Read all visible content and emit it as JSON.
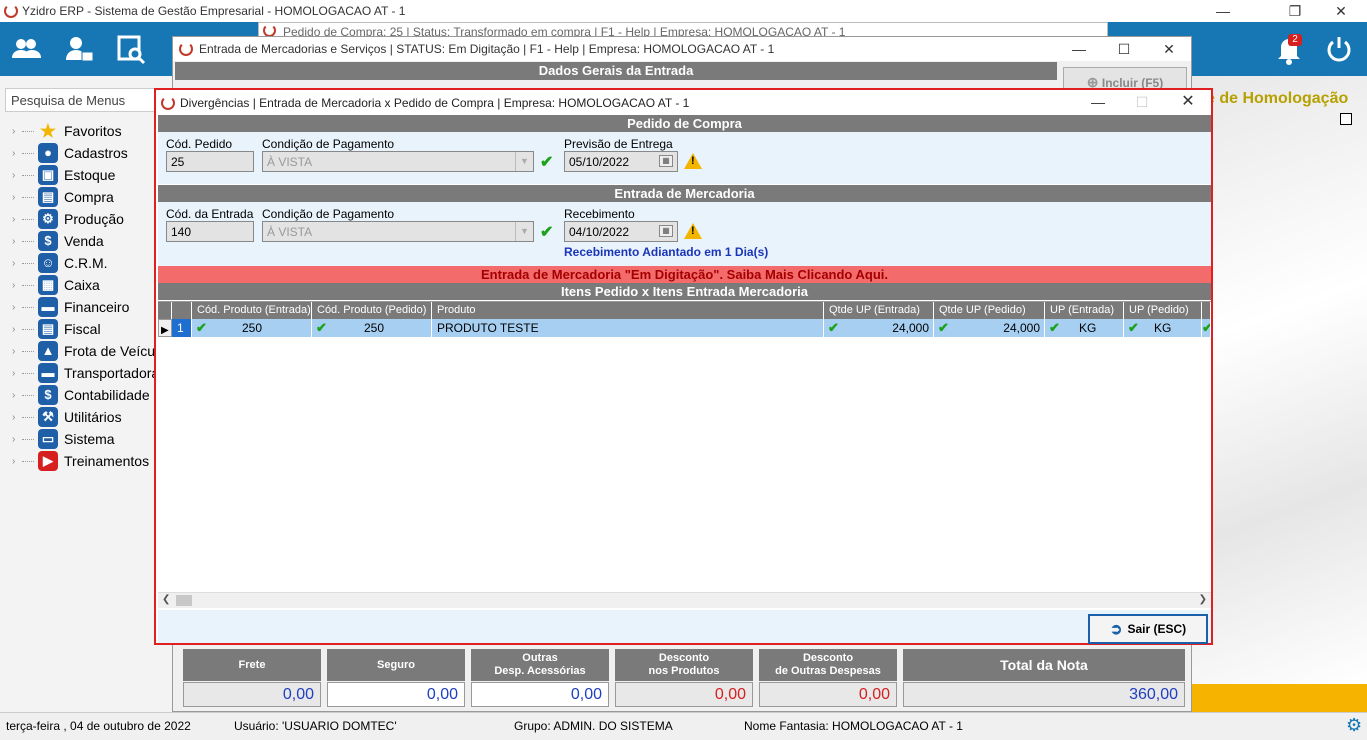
{
  "app": {
    "title": "Yzidro ERP - Sistema de Gestão Empresarial - HOMOLOGACAO AT - 1",
    "notifications_count": "2",
    "homolog_label": "e de Homologação"
  },
  "menu": {
    "search_placeholder": "Pesquisa de Menus",
    "items": [
      {
        "label": "Favoritos",
        "icon": "star-icon",
        "color": "#f2b600"
      },
      {
        "label": "Cadastros",
        "icon": "person-icon",
        "color": "#1f5fa8"
      },
      {
        "label": "Estoque",
        "icon": "box-icon",
        "color": "#1f5fa8"
      },
      {
        "label": "Compra",
        "icon": "basket-icon",
        "color": "#1f5fa8"
      },
      {
        "label": "Produção",
        "icon": "gear-icon",
        "color": "#1f5fa8"
      },
      {
        "label": "Venda",
        "icon": "money-bag-icon",
        "color": "#1f5fa8"
      },
      {
        "label": "C.R.M.",
        "icon": "people-icon",
        "color": "#1f5fa8"
      },
      {
        "label": "Caixa",
        "icon": "register-icon",
        "color": "#1f5fa8"
      },
      {
        "label": "Financeiro",
        "icon": "cash-icon",
        "color": "#1f5fa8"
      },
      {
        "label": "Fiscal",
        "icon": "document-icon",
        "color": "#1f5fa8"
      },
      {
        "label": "Frota de Veículo",
        "icon": "car-icon",
        "color": "#1f5fa8"
      },
      {
        "label": "Transportadora",
        "icon": "truck-icon",
        "color": "#1f5fa8"
      },
      {
        "label": "Contabilidade Fin",
        "icon": "coin-icon",
        "color": "#1f5fa8"
      },
      {
        "label": "Utilitários",
        "icon": "tools-icon",
        "color": "#1f5fa8"
      },
      {
        "label": "Sistema",
        "icon": "monitor-icon",
        "color": "#1f5fa8"
      },
      {
        "label": "Treinamentos",
        "icon": "youtube-icon",
        "color": "#d61f1f"
      }
    ]
  },
  "win_pedido": {
    "title": "Pedido de Compra: 25 | Status: Transformado em compra | F1 - Help | Empresa: HOMOLOGACAO AT - 1"
  },
  "win_entrada": {
    "title": "Entrada de Mercadorias e Serviços | STATUS: Em Digitação | F1 - Help | Empresa: HOMOLOGACAO AT - 1",
    "section_title": "Dados Gerais da Entrada",
    "incluir_label": "Incluir (F5)",
    "totals": [
      {
        "label": "Frete",
        "value": "0,00",
        "value_color": "#1f3fbf",
        "white": false
      },
      {
        "label": "Seguro",
        "value": "0,00",
        "value_color": "#1f3fbf",
        "white": true
      },
      {
        "label": "Outras\nDesp. Acessórias",
        "value": "0,00",
        "value_color": "#1f3fbf",
        "white": true
      },
      {
        "label": "Desconto\nnos Produtos",
        "value": "0,00",
        "value_color": "#d61f1f",
        "white": false
      },
      {
        "label": "Desconto\nde Outras Despesas",
        "value": "0,00",
        "value_color": "#d61f1f",
        "white": false
      },
      {
        "label": "Total da Nota",
        "value": "360,00",
        "value_color": "#1f3fbf",
        "white": false
      }
    ]
  },
  "dialog": {
    "title": "Divergências | Entrada de Mercadoria x Pedido de Compra | Empresa: HOMOLOGACAO AT - 1",
    "pedido": {
      "section": "Pedido de Compra",
      "cod_label": "Cód. Pedido",
      "cod_value": "25",
      "cond_label": "Condição de Pagamento",
      "cond_value": "À VISTA",
      "prev_label": "Previsão de Entrega",
      "prev_value": "05/10/2022"
    },
    "entrada": {
      "section": "Entrada de Mercadoria",
      "cod_label": "Cód. da Entrada",
      "cod_value": "140",
      "cond_label": "Condição de Pagamento",
      "cond_value": "À VISTA",
      "receb_label": "Recebimento",
      "receb_value": "04/10/2022",
      "receb_note": "Recebimento Adiantado em 1 Dia(s)"
    },
    "banner": "Entrada de Mercadoria \"Em Digitação\". Saiba Mais Clicando Aqui.",
    "items_title": "Itens Pedido x Itens Entrada Mercadoria",
    "columns": [
      "Cód. Produto (Entrada)",
      "Cód. Produto (Pedido)",
      "Produto",
      "Qtde UP (Entrada)",
      "Qtde UP (Pedido)",
      "UP (Entrada)",
      "UP (Pedido)"
    ],
    "rows": [
      {
        "num": "1",
        "cod_entrada": "250",
        "cod_pedido": "250",
        "produto": "PRODUTO TESTE",
        "qtde_entrada": "24,000",
        "qtde_pedido": "24,000",
        "up_entrada": "KG",
        "up_pedido": "KG"
      }
    ],
    "sair_label": "Sair (ESC)"
  },
  "statusbar": {
    "date": "terça-feira , 04 de outubro de 2022",
    "usuario": "Usuário: 'USUARIO DOMTEC'",
    "grupo": "Grupo: ADMIN. DO SISTEMA",
    "fantasia": "Nome Fantasia: HOMOLOGACAO AT - 1"
  }
}
